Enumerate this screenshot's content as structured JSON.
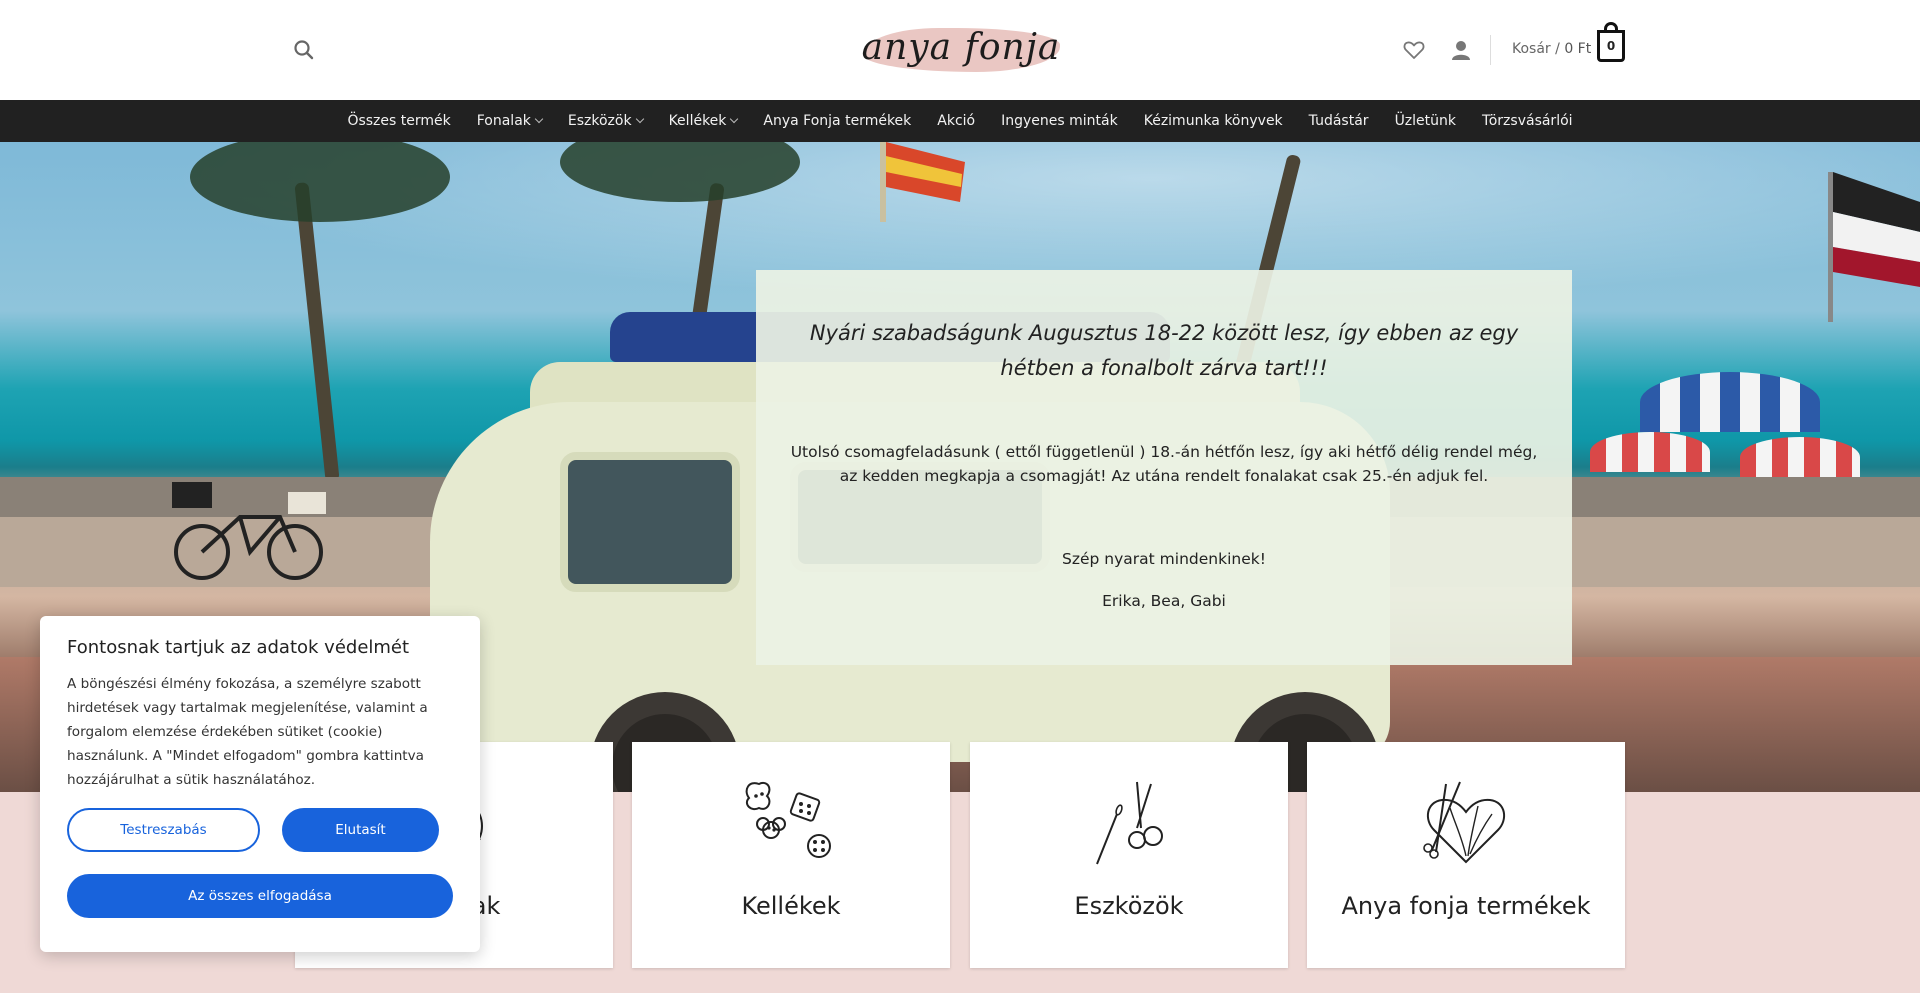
{
  "header": {
    "logo_text": "anya fonja",
    "cart_label": "Kosár /",
    "cart_total": "0 Ft",
    "cart_count": "0"
  },
  "icons": {
    "search": "search-icon",
    "wishlist": "heart-icon",
    "account": "user-icon",
    "cart": "shopping-bag-icon"
  },
  "nav": {
    "items": [
      {
        "label": "Összes termék",
        "has_dropdown": false
      },
      {
        "label": "Fonalak",
        "has_dropdown": true
      },
      {
        "label": "Eszközök",
        "has_dropdown": true
      },
      {
        "label": "Kellékek",
        "has_dropdown": true
      },
      {
        "label": "Anya Fonja termékek",
        "has_dropdown": false
      },
      {
        "label": "Akció",
        "has_dropdown": false
      },
      {
        "label": "Ingyenes minták",
        "has_dropdown": false
      },
      {
        "label": "Kézimunka könyvek",
        "has_dropdown": false
      },
      {
        "label": "Tudástár",
        "has_dropdown": false
      },
      {
        "label": "Üzletünk",
        "has_dropdown": false
      },
      {
        "label": "Törzsvásárlói",
        "has_dropdown": false
      }
    ]
  },
  "notice": {
    "title": "Nyári szabadságunk Augusztus 18-22 között lesz, így ebben az egy hétben a fonalbolt zárva tart!!!",
    "body": "Utolsó csomagfeladásunk ( ettől függetlenül ) 18.-án hétfőn lesz, így aki hétfő délig rendel még, az kedden megkapja a csomagját! Az utána rendelt fonalakat csak 25.-én adjuk fel.",
    "wish": "Szép nyarat mindenkinek!",
    "signature": "Erika, Bea, Gabi"
  },
  "categories": [
    {
      "label": "Fonalak",
      "icon": "yarn-ball-icon"
    },
    {
      "label": "Kellékek",
      "icon": "buttons-icon"
    },
    {
      "label": "Eszközök",
      "icon": "scissors-needle-icon"
    },
    {
      "label": "Anya fonja termékek",
      "icon": "knitting-heart-icon"
    }
  ],
  "cookie": {
    "title": "Fontosnak tartjuk az adatok védelmét",
    "text": "A böngészési élmény fokozása, a személyre szabott hirdetések vagy tartalmak megjelenítése, valamint a forgalom elemzése érdekében sütiket (cookie) használunk. A \"Mindet elfogadom\" gombra kattintva hozzájárulhat a sütik használatához.",
    "customize": "Testreszabás",
    "reject": "Elutasít",
    "accept_all": "Az összes elfogadása",
    "accent": "#1863dc"
  },
  "colors": {
    "nav_bg": "#212121",
    "page_bg": "#efd9d6",
    "logo_accent": "#e8c1bd"
  }
}
